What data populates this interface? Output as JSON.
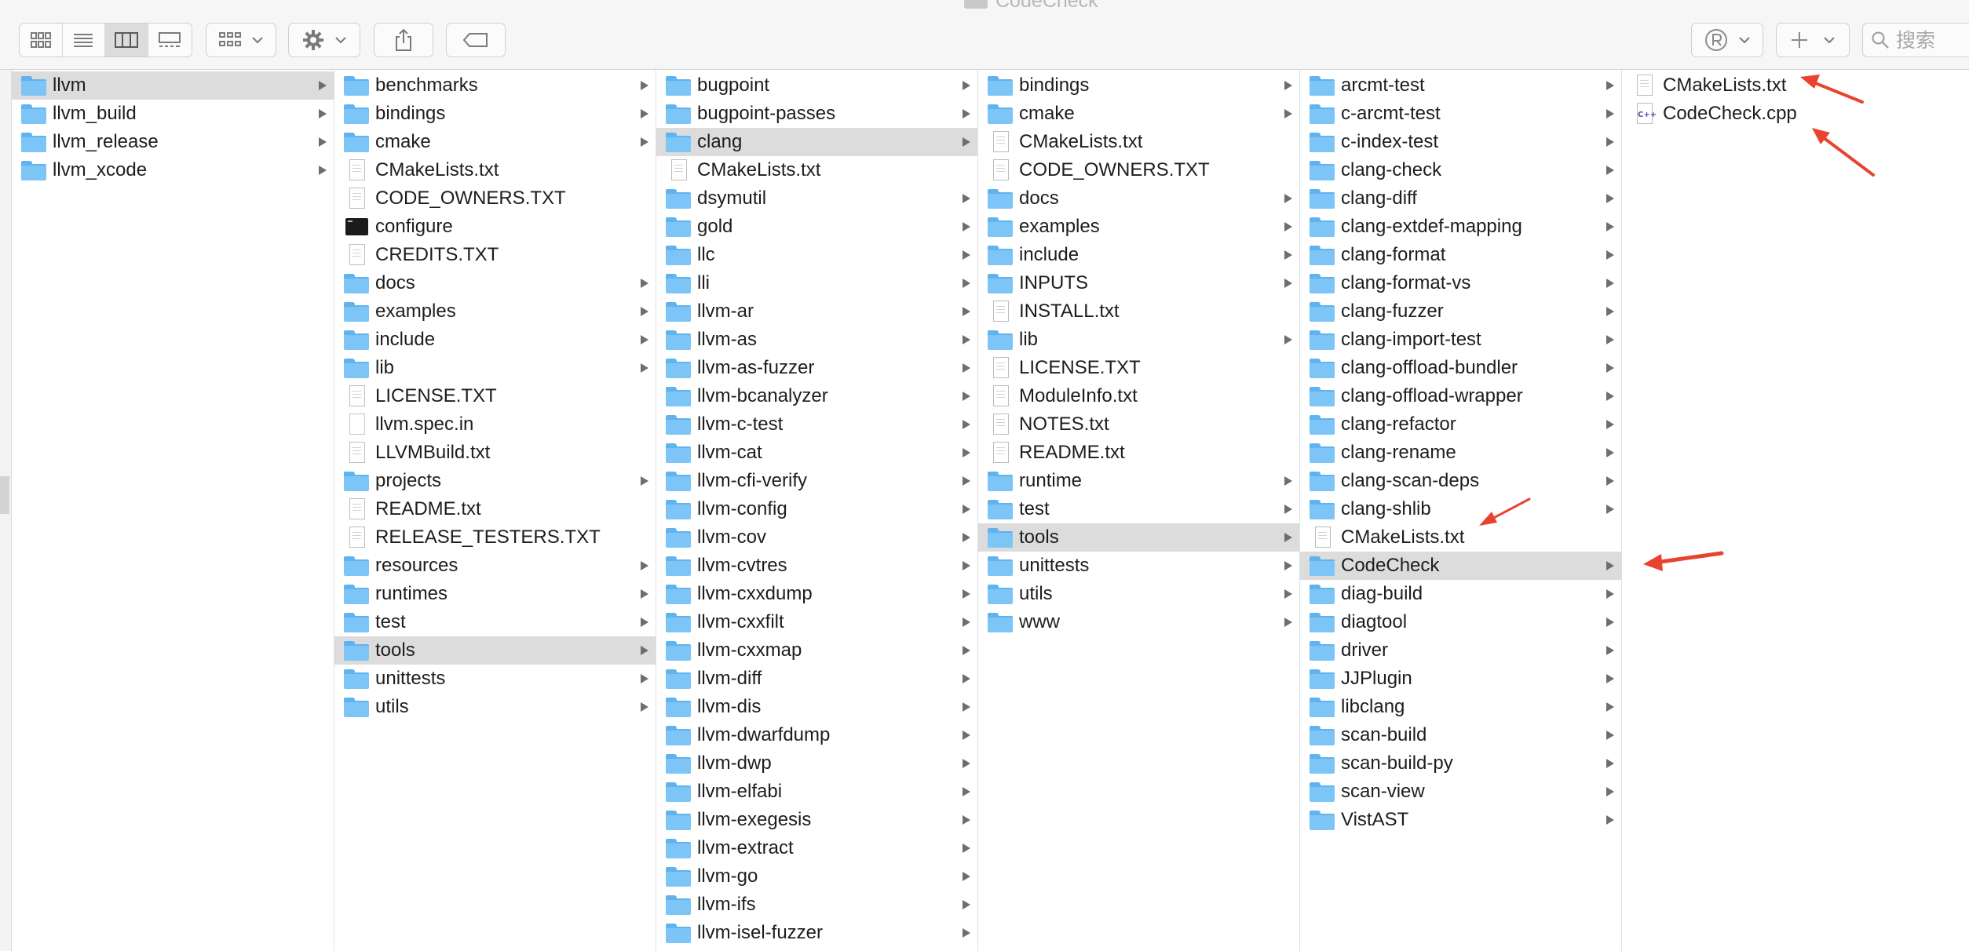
{
  "window": {
    "title": "CodeCheck"
  },
  "toolbar": {
    "view_buttons": [
      "icon-view-icon",
      "list-view-icon",
      "column-view-icon",
      "gallery-view-icon"
    ],
    "search_placeholder": "搜索"
  },
  "columns": [
    {
      "items": [
        {
          "name": "llvm",
          "kind": "folder",
          "selected": true
        },
        {
          "name": "llvm_build",
          "kind": "folder"
        },
        {
          "name": "llvm_release",
          "kind": "folder"
        },
        {
          "name": "llvm_xcode",
          "kind": "folder"
        }
      ]
    },
    {
      "items": [
        {
          "name": "benchmarks",
          "kind": "folder"
        },
        {
          "name": "bindings",
          "kind": "folder"
        },
        {
          "name": "cmake",
          "kind": "folder"
        },
        {
          "name": "CMakeLists.txt",
          "kind": "doc"
        },
        {
          "name": "CODE_OWNERS.TXT",
          "kind": "doc"
        },
        {
          "name": "configure",
          "kind": "exec"
        },
        {
          "name": "CREDITS.TXT",
          "kind": "doc"
        },
        {
          "name": "docs",
          "kind": "folder"
        },
        {
          "name": "examples",
          "kind": "folder"
        },
        {
          "name": "include",
          "kind": "folder"
        },
        {
          "name": "lib",
          "kind": "folder"
        },
        {
          "name": "LICENSE.TXT",
          "kind": "doc"
        },
        {
          "name": "llvm.spec.in",
          "kind": "blank"
        },
        {
          "name": "LLVMBuild.txt",
          "kind": "doc"
        },
        {
          "name": "projects",
          "kind": "folder"
        },
        {
          "name": "README.txt",
          "kind": "doc"
        },
        {
          "name": "RELEASE_TESTERS.TXT",
          "kind": "doc"
        },
        {
          "name": "resources",
          "kind": "folder"
        },
        {
          "name": "runtimes",
          "kind": "folder"
        },
        {
          "name": "test",
          "kind": "folder"
        },
        {
          "name": "tools",
          "kind": "folder",
          "selected": true
        },
        {
          "name": "unittests",
          "kind": "folder"
        },
        {
          "name": "utils",
          "kind": "folder"
        }
      ]
    },
    {
      "items": [
        {
          "name": "bugpoint",
          "kind": "folder"
        },
        {
          "name": "bugpoint-passes",
          "kind": "folder"
        },
        {
          "name": "clang",
          "kind": "folder",
          "selected": true
        },
        {
          "name": "CMakeLists.txt",
          "kind": "doc"
        },
        {
          "name": "dsymutil",
          "kind": "folder"
        },
        {
          "name": "gold",
          "kind": "folder"
        },
        {
          "name": "llc",
          "kind": "folder"
        },
        {
          "name": "lli",
          "kind": "folder"
        },
        {
          "name": "llvm-ar",
          "kind": "folder"
        },
        {
          "name": "llvm-as",
          "kind": "folder"
        },
        {
          "name": "llvm-as-fuzzer",
          "kind": "folder"
        },
        {
          "name": "llvm-bcanalyzer",
          "kind": "folder"
        },
        {
          "name": "llvm-c-test",
          "kind": "folder"
        },
        {
          "name": "llvm-cat",
          "kind": "folder"
        },
        {
          "name": "llvm-cfi-verify",
          "kind": "folder"
        },
        {
          "name": "llvm-config",
          "kind": "folder"
        },
        {
          "name": "llvm-cov",
          "kind": "folder"
        },
        {
          "name": "llvm-cvtres",
          "kind": "folder"
        },
        {
          "name": "llvm-cxxdump",
          "kind": "folder"
        },
        {
          "name": "llvm-cxxfilt",
          "kind": "folder"
        },
        {
          "name": "llvm-cxxmap",
          "kind": "folder"
        },
        {
          "name": "llvm-diff",
          "kind": "folder"
        },
        {
          "name": "llvm-dis",
          "kind": "folder"
        },
        {
          "name": "llvm-dwarfdump",
          "kind": "folder"
        },
        {
          "name": "llvm-dwp",
          "kind": "folder"
        },
        {
          "name": "llvm-elfabi",
          "kind": "folder"
        },
        {
          "name": "llvm-exegesis",
          "kind": "folder"
        },
        {
          "name": "llvm-extract",
          "kind": "folder"
        },
        {
          "name": "llvm-go",
          "kind": "folder"
        },
        {
          "name": "llvm-ifs",
          "kind": "folder"
        },
        {
          "name": "llvm-isel-fuzzer",
          "kind": "folder"
        }
      ]
    },
    {
      "items": [
        {
          "name": "bindings",
          "kind": "folder"
        },
        {
          "name": "cmake",
          "kind": "folder"
        },
        {
          "name": "CMakeLists.txt",
          "kind": "doc"
        },
        {
          "name": "CODE_OWNERS.TXT",
          "kind": "doc"
        },
        {
          "name": "docs",
          "kind": "folder"
        },
        {
          "name": "examples",
          "kind": "folder"
        },
        {
          "name": "include",
          "kind": "folder"
        },
        {
          "name": "INPUTS",
          "kind": "folder"
        },
        {
          "name": "INSTALL.txt",
          "kind": "doc"
        },
        {
          "name": "lib",
          "kind": "folder"
        },
        {
          "name": "LICENSE.TXT",
          "kind": "doc"
        },
        {
          "name": "ModuleInfo.txt",
          "kind": "doc"
        },
        {
          "name": "NOTES.txt",
          "kind": "doc"
        },
        {
          "name": "README.txt",
          "kind": "doc"
        },
        {
          "name": "runtime",
          "kind": "folder"
        },
        {
          "name": "test",
          "kind": "folder"
        },
        {
          "name": "tools",
          "kind": "folder",
          "selected": true
        },
        {
          "name": "unittests",
          "kind": "folder"
        },
        {
          "name": "utils",
          "kind": "folder"
        },
        {
          "name": "www",
          "kind": "folder"
        }
      ]
    },
    {
      "items": [
        {
          "name": "arcmt-test",
          "kind": "folder"
        },
        {
          "name": "c-arcmt-test",
          "kind": "folder"
        },
        {
          "name": "c-index-test",
          "kind": "folder"
        },
        {
          "name": "clang-check",
          "kind": "folder"
        },
        {
          "name": "clang-diff",
          "kind": "folder"
        },
        {
          "name": "clang-extdef-mapping",
          "kind": "folder"
        },
        {
          "name": "clang-format",
          "kind": "folder"
        },
        {
          "name": "clang-format-vs",
          "kind": "folder"
        },
        {
          "name": "clang-fuzzer",
          "kind": "folder"
        },
        {
          "name": "clang-import-test",
          "kind": "folder"
        },
        {
          "name": "clang-offload-bundler",
          "kind": "folder"
        },
        {
          "name": "clang-offload-wrapper",
          "kind": "folder"
        },
        {
          "name": "clang-refactor",
          "kind": "folder"
        },
        {
          "name": "clang-rename",
          "kind": "folder"
        },
        {
          "name": "clang-scan-deps",
          "kind": "folder"
        },
        {
          "name": "clang-shlib",
          "kind": "folder"
        },
        {
          "name": "CMakeLists.txt",
          "kind": "doc"
        },
        {
          "name": "CodeCheck",
          "kind": "folder",
          "selected": true
        },
        {
          "name": "diag-build",
          "kind": "folder"
        },
        {
          "name": "diagtool",
          "kind": "folder"
        },
        {
          "name": "driver",
          "kind": "folder"
        },
        {
          "name": "JJPlugin",
          "kind": "folder"
        },
        {
          "name": "libclang",
          "kind": "folder"
        },
        {
          "name": "scan-build",
          "kind": "folder"
        },
        {
          "name": "scan-build-py",
          "kind": "folder"
        },
        {
          "name": "scan-view",
          "kind": "folder"
        },
        {
          "name": "VistAST",
          "kind": "folder"
        }
      ]
    },
    {
      "items": [
        {
          "name": "CMakeLists.txt",
          "kind": "doc"
        },
        {
          "name": "CodeCheck.cpp",
          "kind": "cpp"
        }
      ]
    }
  ],
  "annotations": {
    "arrow_color": "#e8432f"
  }
}
